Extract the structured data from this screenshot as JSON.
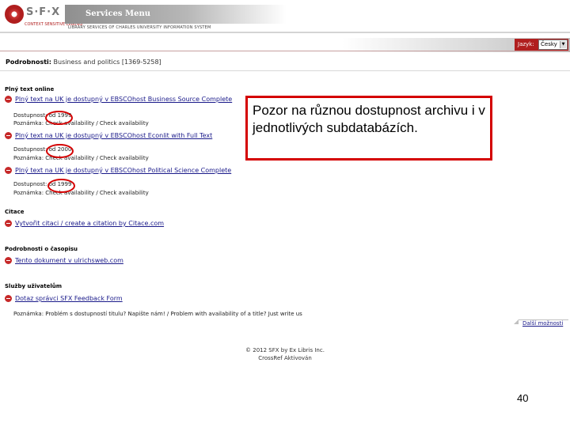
{
  "header": {
    "logo_text": "S·F·X",
    "logo_subtitle": "CONTEXT SENSITIVE LINKING",
    "title": "Services Menu",
    "subtitle": "LIBRARY SERVICES OF CHARLES UNIVERSITY INFORMATION SYSTEM"
  },
  "language": {
    "label": "Jazyk:",
    "selected": "Česky"
  },
  "details": {
    "label": "Podrobnosti:",
    "value": "Business and politics [1369-5258]"
  },
  "fulltext": {
    "title": "Plný text online",
    "items": [
      {
        "prefix": "Plný text na UK je dostupný v ",
        "link": "EBSCOhost Business Source Complete",
        "availability": "Dostupnost: od 1999",
        "note": "Poznámka: Check availability / Check availability"
      },
      {
        "prefix": "Plný text na UK je dostupný v ",
        "link": "EBSCOhost Econlit with Full Text",
        "availability": "Dostupnost: od 2000",
        "note": "Poznámka: Check availability / Check availability"
      },
      {
        "prefix": "Plný text na UK je dostupný v ",
        "link": "EBSCOhost Political Science Complete",
        "availability": "Dostupnost: od 1999",
        "note": "Poznámka: Check availability / Check availability"
      }
    ]
  },
  "citation": {
    "title": "Citace",
    "link_text": "Vytvořit citaci / create a citation by ",
    "link_service": "Citace.com"
  },
  "journal": {
    "title": "Podrobnosti o časopisu",
    "link_text": "Tento dokument v ulrichsweb.com"
  },
  "user_services": {
    "title": "Služby uživatelům",
    "link_text": "Dotaz správci SFX Feedback Form",
    "note": "Poznámka: Problém s dostupností titulu? Napište nám! / Problem with availability of a title? Just write us"
  },
  "more_options": "Další možnosti",
  "footer": {
    "copyright": "© 2012 SFX by Ex Libris Inc.",
    "crossref": "CrossRef Aktivován"
  },
  "callout": {
    "text": "Pozor na různou dostupnost archivu i v jednotlivých subdatabázích."
  },
  "slide_number": "40",
  "colors": {
    "accent_red": "#d40000",
    "link_blue": "#1a1a8a"
  }
}
